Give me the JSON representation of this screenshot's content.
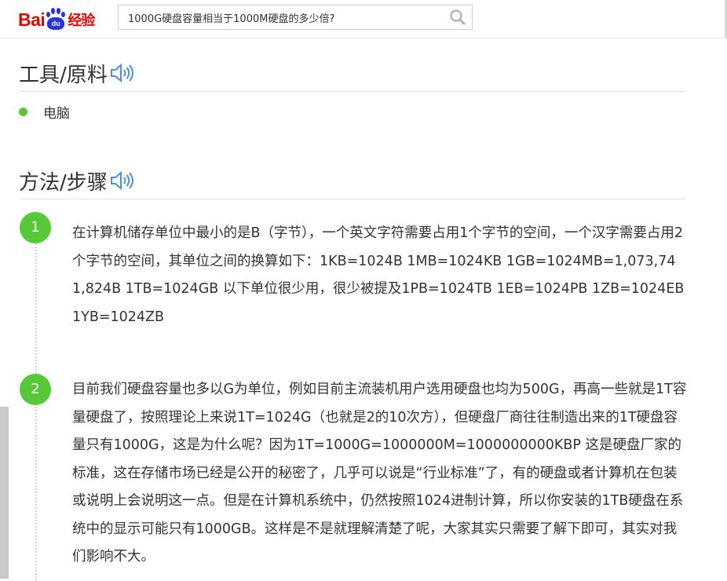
{
  "header": {
    "logo": {
      "brand": "Bai",
      "paw_text": "du",
      "suffix": "经验"
    },
    "search": {
      "value": "1000G硬盘容量相当于1000M硬盘的多少倍?",
      "placeholder": ""
    }
  },
  "tools": {
    "title": "工具/原料",
    "items": [
      {
        "label": "电脑"
      }
    ]
  },
  "steps": {
    "title": "方法/步骤",
    "items": [
      {
        "number": "1",
        "text": " 在计算机储存单位中最小的是B（字节），一个英文字符需要占用1个字节的空间，一个汉字需要占用2个字节的空间，其单位之间的换算如下：1KB=1024B 1MB=1024KB 1GB=1024MB=1,073,741,824B 1TB=1024GB 以下单位很少用，很少被提及1PB=1024TB 1EB=1024PB 1ZB=1024EB 1YB=1024ZB"
      },
      {
        "number": "2",
        "text": "目前我们硬盘容量也多以G为单位，例如目前主流装机用户选用硬盘也均为500G，再高一些就是1T容量硬盘了，按照理论上来说1T=1024G（也就是2的10次方），但硬盘厂商往往制造出来的1T硬盘容量只有1000G，这是为什么呢？因为1T=1000G=1000000M=1000000000KBP 这是硬盘厂家的标准，这在存储市场已经是公开的秘密了，几乎可以说是“行业标准”了，有的硬盘或者计算机在包装或说明上会说明这一点。但是在计算机系统中，仍然按照1024进制计算，所以你安装的1TB硬盘在系统中的显示可能只有1000GB。这样是不是就理解清楚了呢，大家其实只需要了解下即可，其实对我们影响不大。"
      }
    ]
  },
  "icons": {
    "search": "search-icon",
    "audio": "speaker-icon",
    "bullet": "bullet-dot-icon"
  },
  "colors": {
    "brand_red": "#e10602",
    "brand_blue": "#2932e1",
    "accent_green": "#57c837",
    "audio_blue": "#4a90d9"
  }
}
